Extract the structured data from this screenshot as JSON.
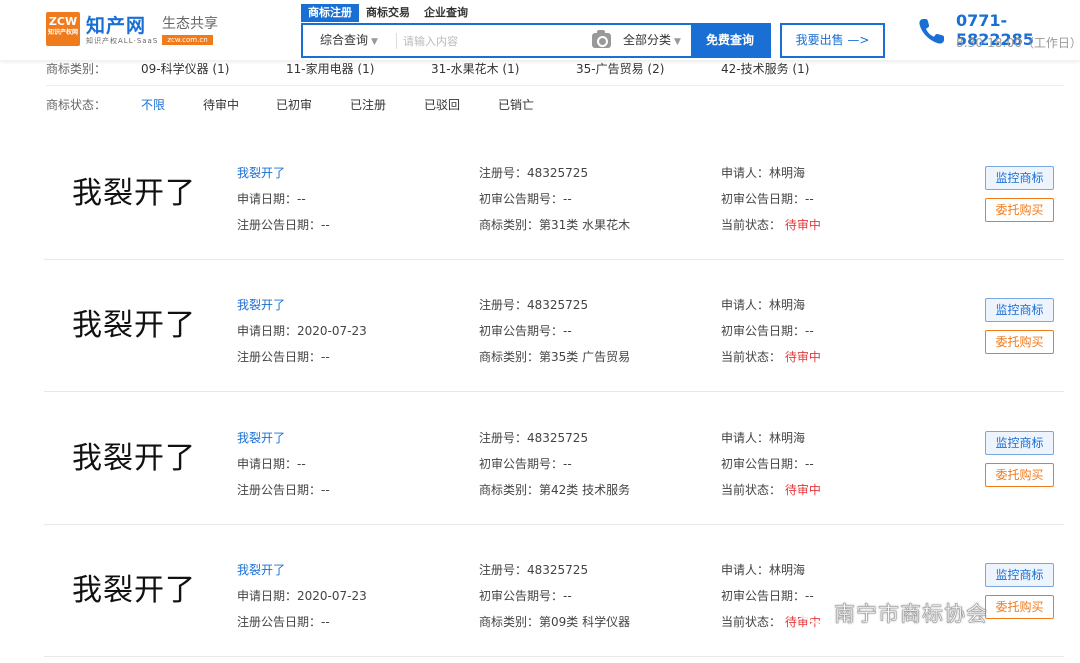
{
  "header": {
    "logo_badge": "ZCW",
    "logo_badge_small": "知识产权网",
    "logo_name": "知产网",
    "logo_sub": "知识产权ALL·SaaS",
    "eco_title": "生态共享",
    "eco_badge": "zcw.com.cn",
    "tabs": [
      {
        "label": "商标注册",
        "active": true
      },
      {
        "label": "商标交易",
        "active": false
      },
      {
        "label": "企业查询",
        "active": false
      }
    ],
    "search": {
      "scope_label": "综合查询",
      "placeholder": "请输入内容",
      "category_label": "全部分类",
      "submit_label": "免费查询"
    },
    "sell_label": "我要出售 —>",
    "phone_number": "0771-5822285",
    "phone_hours": "8:30-18:00（工作日）"
  },
  "filters": {
    "category_label": "商标类别：",
    "categories": [
      "09-科学仪器 (1)",
      "11-家用电器 (1)",
      "31-水果花木 (1)",
      "35-广告贸易 (2)",
      "42-技术服务 (1)"
    ],
    "status_label": "商标状态：",
    "statuses": [
      "不限",
      "待审中",
      "已初审",
      "已注册",
      "已驳回",
      "已销亡"
    ]
  },
  "results": [
    {
      "image_text": "我裂开了",
      "name": "我裂开了",
      "apply_date": "申请日期：--",
      "reg_pub_date": "注册公告日期：--",
      "reg_no": "注册号：48325725",
      "prelim_pub_no": "初审公告期号：--",
      "category": "商标类别：第31类 水果花木",
      "applicant": "申请人：林明海",
      "prelim_pub_date": "初审公告日期：--",
      "status_label": "当前状态：",
      "status_value": "待审中",
      "monitor_label": "监控商标",
      "buy_label": "委托购买"
    },
    {
      "image_text": "我裂开了",
      "name": "我裂开了",
      "apply_date": "申请日期：2020-07-23",
      "reg_pub_date": "注册公告日期：--",
      "reg_no": "注册号：48325725",
      "prelim_pub_no": "初审公告期号：--",
      "category": "商标类别：第35类 广告贸易",
      "applicant": "申请人：林明海",
      "prelim_pub_date": "初审公告日期：--",
      "status_label": "当前状态：",
      "status_value": "待审中",
      "monitor_label": "监控商标",
      "buy_label": "委托购买"
    },
    {
      "image_text": "我裂开了",
      "name": "我裂开了",
      "apply_date": "申请日期：--",
      "reg_pub_date": "注册公告日期：--",
      "reg_no": "注册号：48325725",
      "prelim_pub_no": "初审公告期号：--",
      "category": "商标类别：第42类 技术服务",
      "applicant": "申请人：林明海",
      "prelim_pub_date": "初审公告日期：--",
      "status_label": "当前状态：",
      "status_value": "待审中",
      "monitor_label": "监控商标",
      "buy_label": "委托购买"
    },
    {
      "image_text": "我裂开了",
      "name": "我裂开了",
      "apply_date": "申请日期：2020-07-23",
      "reg_pub_date": "注册公告日期：--",
      "reg_no": "注册号：48325725",
      "prelim_pub_no": "初审公告期号：--",
      "category": "商标类别：第09类 科学仪器",
      "applicant": "申请人：林明海",
      "prelim_pub_date": "初审公告日期：--",
      "status_label": "当前状态：",
      "status_value": "待审中",
      "monitor_label": "监控商标",
      "buy_label": "委托购买"
    }
  ],
  "watermark": "南宁市商标协会",
  "colors": {
    "brand_blue": "#1a6fd4",
    "brand_orange": "#f07b1d",
    "status_red": "#e4393c"
  }
}
